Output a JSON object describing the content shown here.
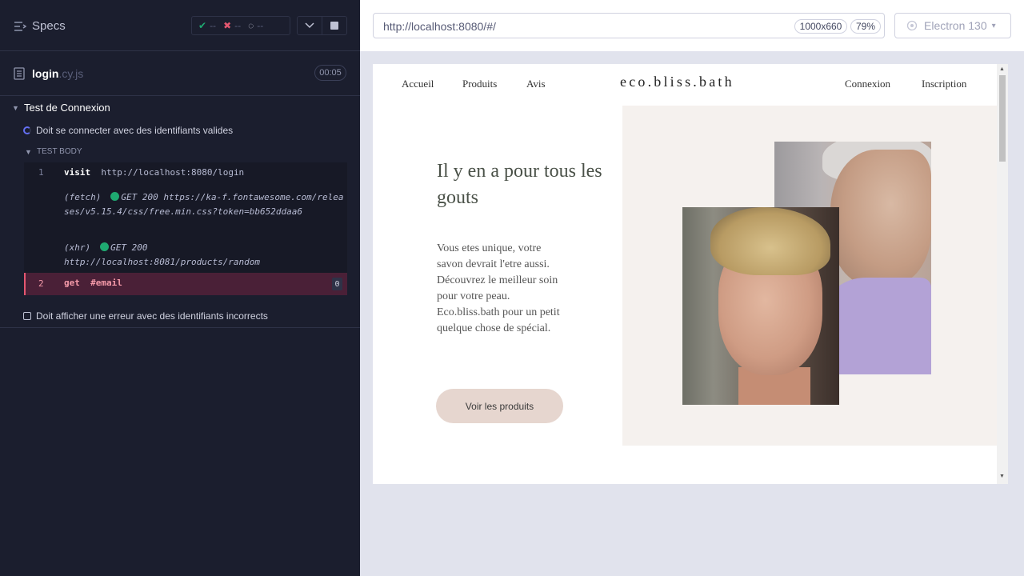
{
  "runner": {
    "specs_title": "Specs",
    "stats": {
      "passed_symbol": "✔",
      "passed": "--",
      "failed_symbol": "✖",
      "failed": "--",
      "pending_symbol": "◌",
      "pending": "--"
    },
    "file": {
      "name": "login",
      "ext": ".cy.js",
      "duration": "00:05"
    },
    "suite_title": "Test de Connexion",
    "test_running": "Doit se connecter avec des identifiants valides",
    "body_label": "TEST BODY",
    "commands": {
      "c1_num": "1",
      "c1_name": "visit",
      "c1_arg": "http://localhost:8080/login",
      "fetch_label": "(fetch)",
      "fetch_text": "GET 200 https://ka-f.fontawesome.com/releases/v5.15.4/css/free.min.css?token=bb652ddaa6",
      "xhr_label": "(xhr)",
      "xhr_text": "GET 200 http://localhost:8081/products/random",
      "c2_num": "2",
      "c2_name": "get",
      "c2_arg": "#email",
      "c2_badge": "0"
    },
    "test_pending": "Doit afficher une erreur avec des identifiants incorrects"
  },
  "topbar": {
    "url": "http://localhost:8080/#/",
    "viewport": "1000x660",
    "zoom": "79%",
    "browser": "Electron 130"
  },
  "app": {
    "nav": {
      "home": "Accueil",
      "products": "Produits",
      "reviews": "Avis",
      "logo": "eco.bliss.bath",
      "login": "Connexion",
      "signup": "Inscription"
    },
    "hero": {
      "title": "Il y en a pour tous les gouts",
      "text": "Vous etes unique, votre savon devrait l'etre aussi. Découvrez le meilleur soin pour votre peau. Eco.bliss.bath pour un petit quelque chose de spécial.",
      "cta": "Voir les produits"
    }
  },
  "colors": {
    "panel_bg": "#1b1e2e",
    "pass": "#1fa971",
    "fail": "#e45770",
    "hero_bg": "#f5f1ee",
    "cta_bg": "#e6d6cf"
  }
}
